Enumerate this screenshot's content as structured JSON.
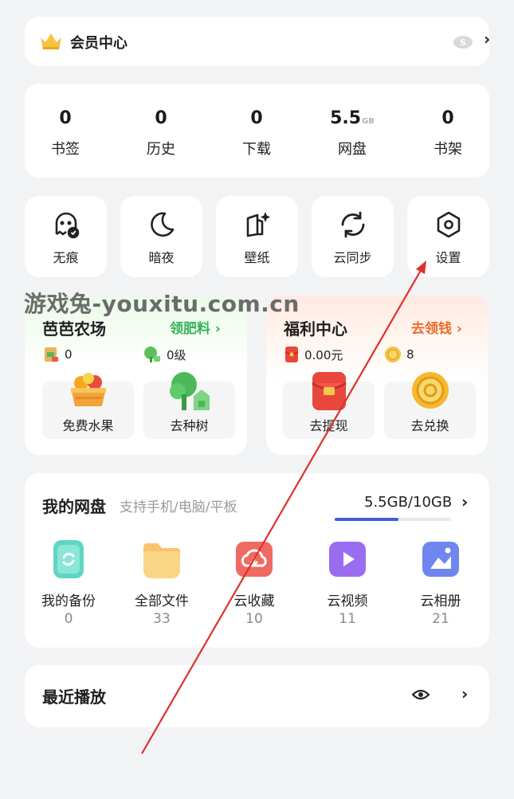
{
  "member": {
    "label": "会员中心",
    "icons": [
      "crown-icon",
      "s-badge-icon",
      "chevron-right-icon"
    ]
  },
  "stats": [
    {
      "num": "0",
      "unit": "",
      "label": "书签"
    },
    {
      "num": "0",
      "unit": "",
      "label": "历史"
    },
    {
      "num": "0",
      "unit": "",
      "label": "下载"
    },
    {
      "num": "5.5",
      "unit": "GB",
      "label": "网盘"
    },
    {
      "num": "0",
      "unit": "",
      "label": "书架"
    }
  ],
  "tools": [
    {
      "label": "无痕",
      "icon": "ghost-icon"
    },
    {
      "label": "暗夜",
      "icon": "moon-icon"
    },
    {
      "label": "壁纸",
      "icon": "wallpaper-icon"
    },
    {
      "label": "云同步",
      "icon": "sync-icon"
    },
    {
      "label": "设置",
      "icon": "settings-hexagon-icon"
    }
  ],
  "farm": {
    "title": "芭芭农场",
    "link": "领肥料",
    "fertilizer": "0",
    "level": "0级",
    "tiles": [
      {
        "label": "免费水果",
        "icon": "fruit-basket-icon"
      },
      {
        "label": "去种树",
        "icon": "tree-icon"
      }
    ]
  },
  "welfare": {
    "title": "福利中心",
    "link": "去领钱",
    "cash": "0.00元",
    "coins": "8",
    "tiles": [
      {
        "label": "去提现",
        "icon": "red-envelope-icon"
      },
      {
        "label": "去兑换",
        "icon": "gold-coin-icon"
      }
    ]
  },
  "disk": {
    "title": "我的网盘",
    "subtitle": "支持手机/电脑/平板",
    "usage": "5.5GB/10GB",
    "used_fraction": 0.55,
    "items": [
      {
        "label": "我的备份",
        "count": "0",
        "icon": "backup-icon",
        "color": "#5fd6c2"
      },
      {
        "label": "全部文件",
        "count": "33",
        "icon": "folder-icon",
        "color": "#f8c46b"
      },
      {
        "label": "云收藏",
        "count": "10",
        "icon": "cloud-collect-icon",
        "color": "#ef6a63"
      },
      {
        "label": "云视频",
        "count": "11",
        "icon": "video-icon",
        "color": "#9a6cf0"
      },
      {
        "label": "云相册",
        "count": "21",
        "icon": "album-icon",
        "color": "#6f86ee"
      }
    ]
  },
  "recent": {
    "title": "最近播放"
  },
  "watermark": "游戏兔-youxitu.com.cn",
  "colors": {
    "green_link": "#34b45a",
    "orange_link": "#ee6a2b",
    "progress": "#3d5fdb",
    "arrow": "#e0302a"
  }
}
